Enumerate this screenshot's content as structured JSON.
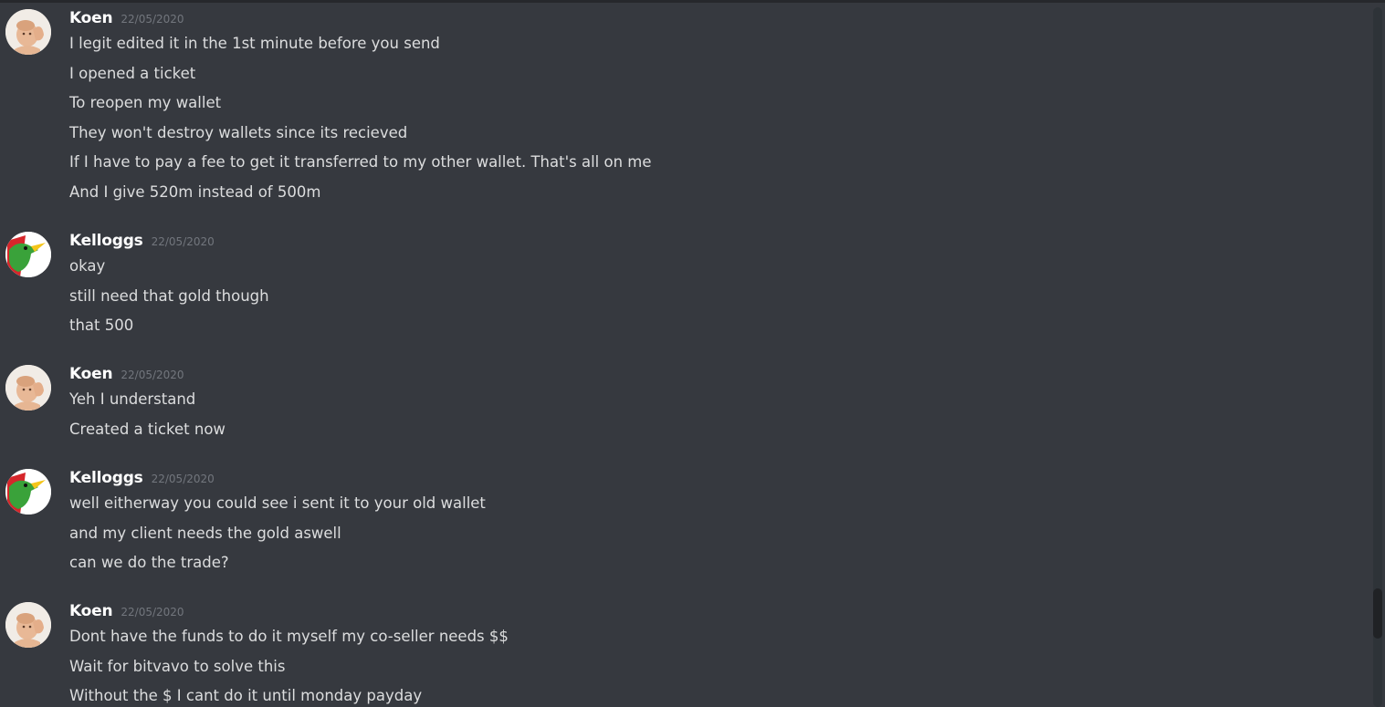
{
  "messages": [
    {
      "author": "Koen",
      "avatar_icon": "koen-avatar-icon",
      "timestamp": "22/05/2020",
      "lines": [
        "I legit edited it in the 1st minute before you send",
        "I opened a ticket",
        "To reopen my wallet",
        "They won't destroy wallets since its recieved",
        "If I have to pay a fee to get it transferred to my other wallet. That's all on me",
        "And I give 520m instead of 500m"
      ]
    },
    {
      "author": "Kelloggs",
      "avatar_icon": "kelloggs-avatar-icon",
      "timestamp": "22/05/2020",
      "lines": [
        "okay",
        "still need that gold though",
        "that 500"
      ]
    },
    {
      "author": "Koen",
      "avatar_icon": "koen-avatar-icon",
      "timestamp": "22/05/2020",
      "lines": [
        "Yeh I understand",
        "Created a ticket now"
      ]
    },
    {
      "author": "Kelloggs",
      "avatar_icon": "kelloggs-avatar-icon",
      "timestamp": "22/05/2020",
      "lines": [
        "well eitherway you could see i sent it to your old wallet",
        "and my client needs the gold aswell",
        "can we do the trade?"
      ]
    },
    {
      "author": "Koen",
      "avatar_icon": "koen-avatar-icon",
      "timestamp": "22/05/2020",
      "lines": [
        "Dont have the funds to do it myself my co-seller needs $$",
        "Wait for bitvavo to solve this",
        "Without the $ I cant do it until monday payday"
      ]
    }
  ],
  "colors": {
    "background": "#36393f",
    "username": "#ffffff",
    "timestamp": "#72767d",
    "message_text": "#dcddde"
  }
}
